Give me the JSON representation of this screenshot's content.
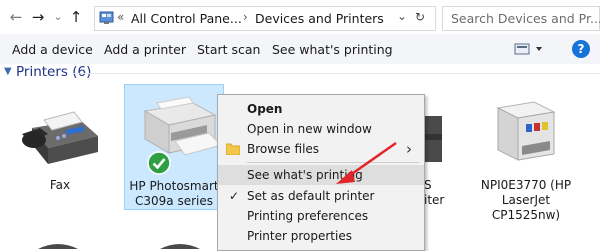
{
  "nav": {
    "back": "←",
    "forward": "→",
    "recent": "⌄",
    "up": "↑"
  },
  "address": {
    "overflow": "«",
    "crumbs": [
      "All Control Pane...",
      "Devices and Printers"
    ],
    "separator": "›",
    "dropdown": "⌄",
    "refresh": "↻"
  },
  "search": {
    "placeholder": "Search Devices and Pr..."
  },
  "commands": {
    "add_device": "Add a device",
    "add_printer": "Add a printer",
    "start_scan": "Start scan",
    "see_printing": "See what's printing",
    "help": "?"
  },
  "section": {
    "title": "Printers (6)"
  },
  "devices": [
    {
      "name_line1": "Fax",
      "name_line2": "",
      "name_line3": ""
    },
    {
      "name_line1": "HP Photosmart",
      "name_line2": "C309a series",
      "name_line3": ""
    },
    {
      "name_line1": "S",
      "name_line2": "iter",
      "name_line3": ""
    },
    {
      "name_line1": "NPI0E3770 (HP",
      "name_line2": "LaserJet",
      "name_line3": "CP1525nw)"
    }
  ],
  "context_menu": {
    "items": [
      {
        "label": "Open"
      },
      {
        "label": "Open in new window"
      },
      {
        "label": "Browse files"
      },
      {
        "label": "See what's printing"
      },
      {
        "label": "Set as default printer"
      },
      {
        "label": "Printing preferences"
      },
      {
        "label": "Printer properties"
      }
    ],
    "submenu_arrow": "›"
  },
  "colors": {
    "accent": "#1673d8",
    "selection": "#cce8ff",
    "arrow": "#e0262b",
    "default_check": "#2ea043"
  }
}
